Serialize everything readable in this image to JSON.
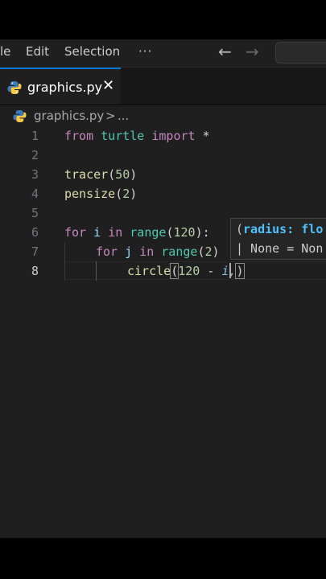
{
  "menubar": {
    "items": [
      "le",
      "Edit",
      "Selection",
      "···"
    ],
    "back_icon": "arrow-left-icon",
    "forward_icon": "arrow-right-icon"
  },
  "tab": {
    "filename": "graphics.py",
    "icon": "python-icon",
    "close_icon": "close-icon",
    "close_glyph": "✕"
  },
  "breadcrumb": {
    "file": "graphics.py",
    "separator": ">",
    "more": "..."
  },
  "editor": {
    "active_line": 8,
    "lines": [
      {
        "num": "1",
        "code": "from turtle import *"
      },
      {
        "num": "2",
        "code": ""
      },
      {
        "num": "3",
        "code": "tracer(50)"
      },
      {
        "num": "4",
        "code": "pensize(2)"
      },
      {
        "num": "5",
        "code": ""
      },
      {
        "num": "6",
        "code": "for i in range(120):"
      },
      {
        "num": "7",
        "code": "    for j in range(2)"
      },
      {
        "num": "8",
        "code": "        circle(120 - i,)"
      }
    ],
    "tokens": {
      "l1": {
        "from": "from",
        "turtle": "turtle",
        "import": "import",
        "star": "*"
      },
      "l3": {
        "fn": "tracer",
        "open": "(",
        "num": "50",
        "close": ")"
      },
      "l4": {
        "fn": "pensize",
        "open": "(",
        "num": "2",
        "close": ")"
      },
      "l6": {
        "for": "for",
        "i": "i",
        "in": "in",
        "range": "range",
        "open": "(",
        "num": "120",
        "close": "):"
      },
      "l7": {
        "for": "for",
        "j": "j",
        "in": "in",
        "range": "range",
        "open": "(",
        "num": "2",
        "close": ")"
      },
      "l8": {
        "fn": "circle",
        "open": "(",
        "num": "120",
        "minus": " - ",
        "hint": "i,",
        "close": ")"
      }
    }
  },
  "signature_help": {
    "line1_open": "(",
    "line1_param": "radius: flo",
    "line2": "| None = Non"
  },
  "colors": {
    "keyword": "#c586c0",
    "function": "#dcdcaa",
    "builtin": "#4ec9b0",
    "number": "#b5cea8",
    "variable": "#9cdcfe",
    "accent": "#0078d4"
  }
}
